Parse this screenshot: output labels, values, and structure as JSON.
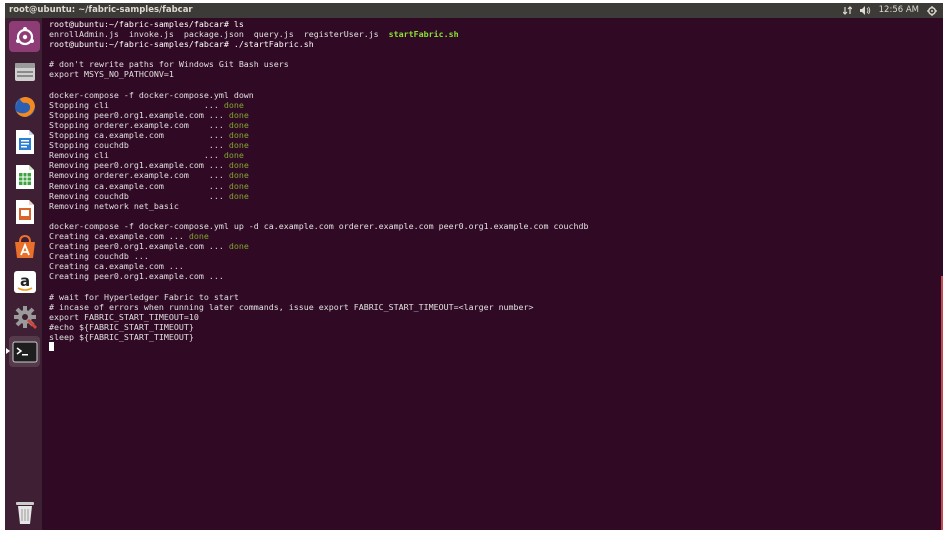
{
  "window": {
    "title": "root@ubuntu: ~/fabric-samples/fabcar"
  },
  "panel": {
    "time": "12:56 AM"
  },
  "launcher": {
    "items": [
      {
        "name": "dash-home-icon"
      },
      {
        "name": "files-icon"
      },
      {
        "name": "firefox-icon"
      },
      {
        "name": "libreoffice-writer-icon"
      },
      {
        "name": "libreoffice-calc-icon"
      },
      {
        "name": "libreoffice-impress-icon"
      },
      {
        "name": "software-center-icon"
      },
      {
        "name": "amazon-icon"
      },
      {
        "name": "system-settings-icon"
      },
      {
        "name": "terminal-icon"
      },
      {
        "name": "trash-icon"
      }
    ]
  },
  "terminal": {
    "ls_prompt": "root@ubuntu:~/fabric-samples/fabcar# ls",
    "ls_files": "enrollAdmin.js  invoke.js  package.json  query.js  registerUser.js  ",
    "ls_exec": "startFabric.sh",
    "run_prompt": "root@ubuntu:~/fabric-samples/fabcar# ./startFabric.sh",
    "comment1": "# don't rewrite paths for Windows Git Bash users",
    "export1": "export MSYS_NO_PATHCONV=1",
    "down_cmd": "docker-compose -f docker-compose.yml down",
    "down_steps": [
      {
        "text": "Stopping cli                   ... ",
        "status": "done"
      },
      {
        "text": "Stopping peer0.org1.example.com ... ",
        "status": "done"
      },
      {
        "text": "Stopping orderer.example.com    ... ",
        "status": "done"
      },
      {
        "text": "Stopping ca.example.com         ... ",
        "status": "done"
      },
      {
        "text": "Stopping couchdb                ... ",
        "status": "done"
      },
      {
        "text": "Removing cli                   ... ",
        "status": "done"
      },
      {
        "text": "Removing peer0.org1.example.com ... ",
        "status": "done"
      },
      {
        "text": "Removing orderer.example.com    ... ",
        "status": "done"
      },
      {
        "text": "Removing ca.example.com         ... ",
        "status": "done"
      },
      {
        "text": "Removing couchdb                ... ",
        "status": "done"
      }
    ],
    "network_removed": "Removing network net_basic",
    "up_cmd": "docker-compose -f docker-compose.yml up -d ca.example.com orderer.example.com peer0.org1.example.com couchdb",
    "up_steps": [
      {
        "text": "Creating ca.example.com ... ",
        "status": "done"
      },
      {
        "text": "Creating peer0.org1.example.com ... ",
        "status": "done"
      },
      {
        "text": "Creating couchdb ...",
        "status": ""
      },
      {
        "text": "Creating ca.example.com ...",
        "status": ""
      },
      {
        "text": "Creating peer0.org1.example.com ...",
        "status": ""
      }
    ],
    "comment2": "# wait for Hyperledger Fabric to start",
    "comment3": "# incase of errors when running later commands, issue export FABRIC_START_TIMEOUT=<larger number>",
    "export2": "export FABRIC_START_TIMEOUT=10",
    "echo_line": "#echo ${FABRIC_START_TIMEOUT}",
    "sleep_line": "sleep ${FABRIC_START_TIMEOUT}"
  }
}
